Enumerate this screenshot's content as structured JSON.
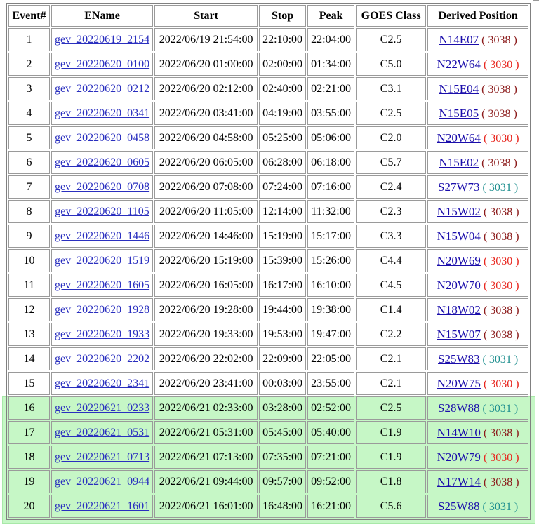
{
  "headers": [
    "Event#",
    "EName",
    "Start",
    "Stop",
    "Peak",
    "GOES Class",
    "Derived Position"
  ],
  "colors": {
    "highlight_bg": "#c6f7c6",
    "link": "#1a0dab",
    "region_3038": "#8b1a1a",
    "region_3030": "#e8261e",
    "region_3031": "#1e8f8f"
  },
  "rows": [
    {
      "num": "1",
      "ename": "gev_20220619_2154",
      "start": "2022/06/19 21:54:00",
      "stop": "22:10:00",
      "peak": "22:04:00",
      "goes": "C2.5",
      "pos": "N14E07",
      "region": "3038"
    },
    {
      "num": "2",
      "ename": "gev_20220620_0100",
      "start": "2022/06/20 01:00:00",
      "stop": "02:00:00",
      "peak": "01:34:00",
      "goes": "C5.0",
      "pos": "N22W64",
      "region": "3030"
    },
    {
      "num": "3",
      "ename": "gev_20220620_0212",
      "start": "2022/06/20 02:12:00",
      "stop": "02:40:00",
      "peak": "02:21:00",
      "goes": "C3.1",
      "pos": "N15E04",
      "region": "3038"
    },
    {
      "num": "4",
      "ename": "gev_20220620_0341",
      "start": "2022/06/20 03:41:00",
      "stop": "04:19:00",
      "peak": "03:55:00",
      "goes": "C2.5",
      "pos": "N15E05",
      "region": "3038"
    },
    {
      "num": "5",
      "ename": "gev_20220620_0458",
      "start": "2022/06/20 04:58:00",
      "stop": "05:25:00",
      "peak": "05:06:00",
      "goes": "C2.0",
      "pos": "N20W64",
      "region": "3030"
    },
    {
      "num": "6",
      "ename": "gev_20220620_0605",
      "start": "2022/06/20 06:05:00",
      "stop": "06:28:00",
      "peak": "06:18:00",
      "goes": "C5.7",
      "pos": "N15E02",
      "region": "3038"
    },
    {
      "num": "7",
      "ename": "gev_20220620_0708",
      "start": "2022/06/20 07:08:00",
      "stop": "07:24:00",
      "peak": "07:16:00",
      "goes": "C2.4",
      "pos": "S27W73",
      "region": "3031"
    },
    {
      "num": "8",
      "ename": "gev_20220620_1105",
      "start": "2022/06/20 11:05:00",
      "stop": "12:14:00",
      "peak": "11:32:00",
      "goes": "C2.3",
      "pos": "N15W02",
      "region": "3038"
    },
    {
      "num": "9",
      "ename": "gev_20220620_1446",
      "start": "2022/06/20 14:46:00",
      "stop": "15:19:00",
      "peak": "15:17:00",
      "goes": "C3.3",
      "pos": "N15W04",
      "region": "3038"
    },
    {
      "num": "10",
      "ename": "gev_20220620_1519",
      "start": "2022/06/20 15:19:00",
      "stop": "15:39:00",
      "peak": "15:26:00",
      "goes": "C4.4",
      "pos": "N20W69",
      "region": "3030"
    },
    {
      "num": "11",
      "ename": "gev_20220620_1605",
      "start": "2022/06/20 16:05:00",
      "stop": "16:17:00",
      "peak": "16:10:00",
      "goes": "C4.5",
      "pos": "N20W70",
      "region": "3030"
    },
    {
      "num": "12",
      "ename": "gev_20220620_1928",
      "start": "2022/06/20 19:28:00",
      "stop": "19:44:00",
      "peak": "19:38:00",
      "goes": "C1.4",
      "pos": "N18W02",
      "region": "3038"
    },
    {
      "num": "13",
      "ename": "gev_20220620_1933",
      "start": "2022/06/20 19:33:00",
      "stop": "19:53:00",
      "peak": "19:47:00",
      "goes": "C2.2",
      "pos": "N15W07",
      "region": "3038"
    },
    {
      "num": "14",
      "ename": "gev_20220620_2202",
      "start": "2022/06/20 22:02:00",
      "stop": "22:09:00",
      "peak": "22:05:00",
      "goes": "C2.1",
      "pos": "S25W83",
      "region": "3031"
    },
    {
      "num": "15",
      "ename": "gev_20220620_2341",
      "start": "2022/06/20 23:41:00",
      "stop": "00:03:00",
      "peak": "23:55:00",
      "goes": "C2.1",
      "pos": "N20W75",
      "region": "3030"
    },
    {
      "num": "16",
      "ename": "gev_20220621_0233",
      "start": "2022/06/21 02:33:00",
      "stop": "03:28:00",
      "peak": "02:52:00",
      "goes": "C2.5",
      "pos": "S28W88",
      "region": "3031"
    },
    {
      "num": "17",
      "ename": "gev_20220621_0531",
      "start": "2022/06/21 05:31:00",
      "stop": "05:45:00",
      "peak": "05:40:00",
      "goes": "C1.9",
      "pos": "N14W10",
      "region": "3038"
    },
    {
      "num": "18",
      "ename": "gev_20220621_0713",
      "start": "2022/06/21 07:13:00",
      "stop": "07:35:00",
      "peak": "07:21:00",
      "goes": "C1.9",
      "pos": "N20W79",
      "region": "3030"
    },
    {
      "num": "19",
      "ename": "gev_20220621_0944",
      "start": "2022/06/21 09:44:00",
      "stop": "09:57:00",
      "peak": "09:52:00",
      "goes": "C1.8",
      "pos": "N17W14",
      "region": "3038"
    },
    {
      "num": "20",
      "ename": "gev_20220621_1601",
      "start": "2022/06/21 16:01:00",
      "stop": "16:48:00",
      "peak": "16:21:00",
      "goes": "C5.6",
      "pos": "S25W88",
      "region": "3031"
    }
  ]
}
